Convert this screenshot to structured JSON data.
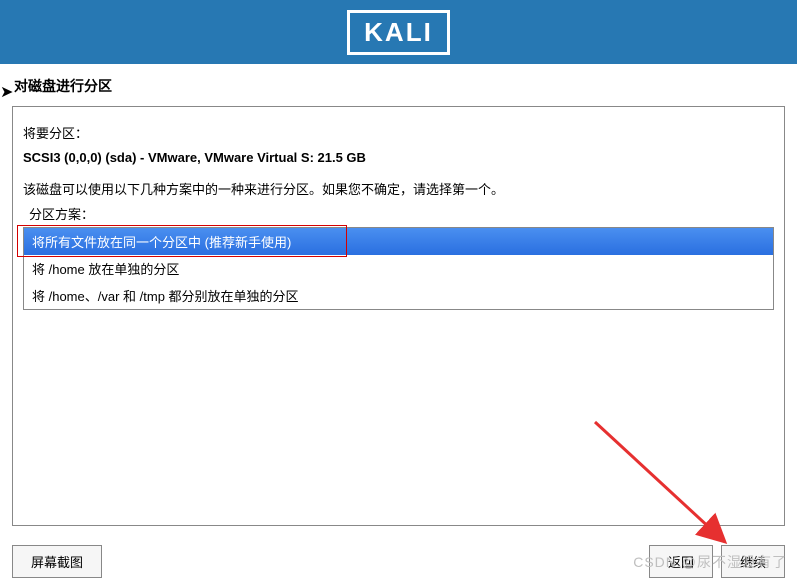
{
  "header": {
    "logo_text": "KALI"
  },
  "section_title": "对磁盘进行分区",
  "panel": {
    "label_partition": "将要分区：",
    "disk_info": "SCSI3 (0,0,0) (sda) - VMware, VMware Virtual S: 21.5 GB",
    "description": "该磁盘可以使用以下几种方案中的一种来进行分区。如果您不确定，请选择第一个。",
    "scheme_label": "分区方案：",
    "options": [
      "将所有文件放在同一个分区中 (推荐新手使用)",
      "将 /home 放在单独的分区",
      "将 /home、/var 和 /tmp 都分别放在单独的分区"
    ]
  },
  "buttons": {
    "screenshot": "屏幕截图",
    "back": "返回",
    "continue": "继续"
  },
  "watermark": "CSDN @尿不湿没有了"
}
